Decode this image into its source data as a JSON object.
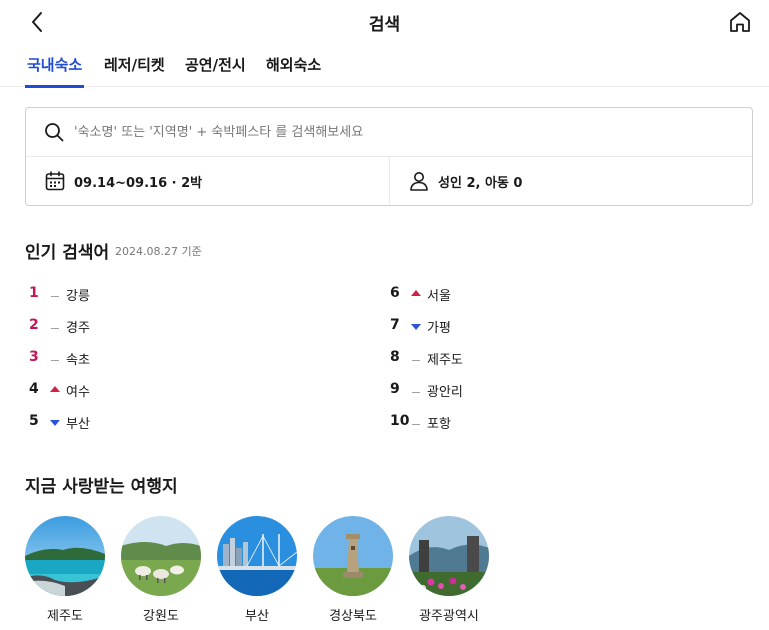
{
  "header": {
    "title": "검색",
    "back_icon": "chevron-left-icon",
    "home_icon": "home-icon"
  },
  "tabs": [
    {
      "label": "국내숙소",
      "active": true
    },
    {
      "label": "레저/티켓",
      "active": false
    },
    {
      "label": "공연/전시",
      "active": false
    },
    {
      "label": "해외숙소",
      "active": false
    }
  ],
  "search": {
    "placeholder": "'숙소명' 또는 '지역명' + 숙박페스타 를 검색해보세요",
    "value": "",
    "date_range": "09.14~09.16 · 2박",
    "guests": "성인 2, 아동 0"
  },
  "popular": {
    "title": "인기 검색어",
    "as_of": "2024.08.27 기준",
    "items": [
      {
        "rank": "1",
        "trend": "same",
        "label": "강릉"
      },
      {
        "rank": "2",
        "trend": "same",
        "label": "경주"
      },
      {
        "rank": "3",
        "trend": "same",
        "label": "속초"
      },
      {
        "rank": "4",
        "trend": "up",
        "label": "여수"
      },
      {
        "rank": "5",
        "trend": "down",
        "label": "부산"
      },
      {
        "rank": "6",
        "trend": "up",
        "label": "서울"
      },
      {
        "rank": "7",
        "trend": "down",
        "label": "가평"
      },
      {
        "rank": "8",
        "trend": "same",
        "label": "제주도"
      },
      {
        "rank": "9",
        "trend": "same",
        "label": "광안리"
      },
      {
        "rank": "10",
        "trend": "same",
        "label": "포항"
      }
    ]
  },
  "loved": {
    "title": "지금 사랑받는 여행지",
    "destinations": [
      {
        "label": "제주도"
      },
      {
        "label": "강원도"
      },
      {
        "label": "부산"
      },
      {
        "label": "경상북도"
      },
      {
        "label": "광주광역시"
      }
    ]
  },
  "colors": {
    "accent": "#1f4bd6",
    "top_rank": "#c2185b",
    "trend_up": "#d1204a",
    "trend_down": "#2a55d6"
  }
}
